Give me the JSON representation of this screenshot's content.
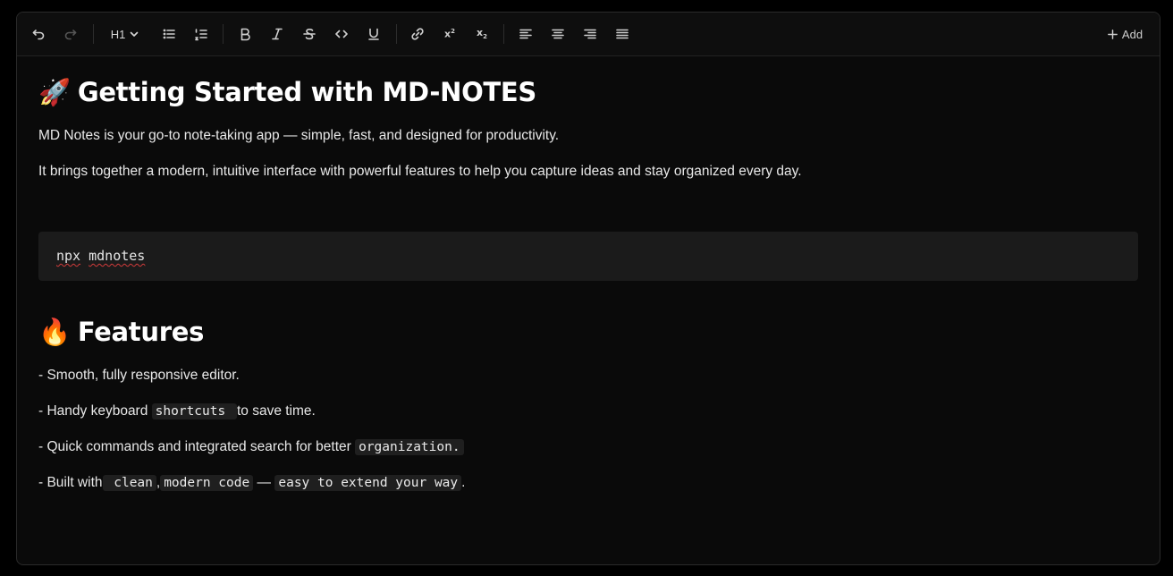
{
  "toolbar": {
    "heading_level": "H1",
    "add_label": "Add",
    "superscript_glyph": "x",
    "superscript_mark": "2",
    "subscript_glyph": "x",
    "subscript_mark": "2"
  },
  "document": {
    "title_emoji": "🚀",
    "title": "Getting Started with MD-NOTES",
    "intro_1": "MD Notes is your go-to note-taking app — simple, fast, and designed for productivity.",
    "intro_2": "It brings together a modern, intuitive interface with powerful features to help you capture ideas and stay organized every day.",
    "code_block": {
      "word_1": "npx",
      "word_2": "mdnotes"
    },
    "features_emoji": "🔥",
    "features_title": "Features",
    "features": {
      "item_1": "- Smooth, fully responsive editor.",
      "item_2_prefix": "- Handy keyboard ",
      "item_2_code": "shortcuts ",
      "item_2_suffix": " to save time.",
      "item_3_prefix": "- Quick commands and integrated search for better ",
      "item_3_code": "organization.",
      "item_4_prefix": "- Built with",
      "item_4_code_1": " clean",
      "item_4_sep_1": ",",
      "item_4_code_2": "modern code",
      "item_4_sep_2": " — ",
      "item_4_code_3": "easy to extend your way",
      "item_4_suffix": "."
    }
  }
}
